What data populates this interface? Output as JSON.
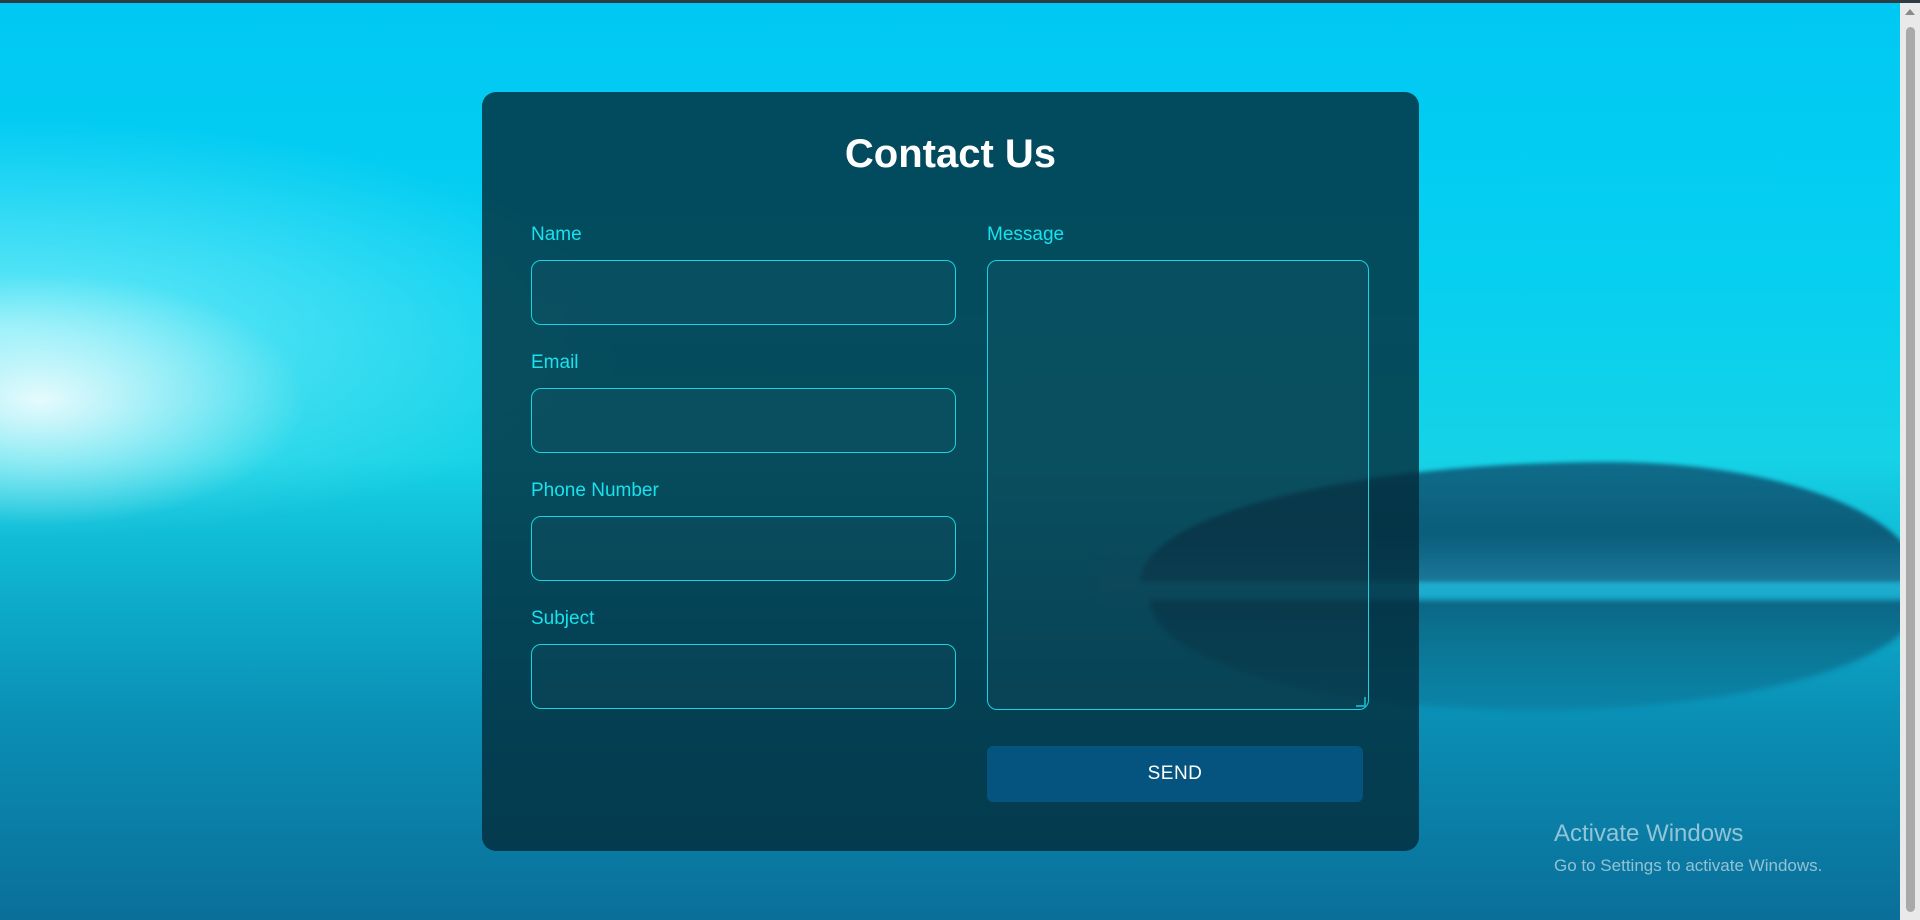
{
  "form": {
    "title": "Contact Us",
    "fields": {
      "name": {
        "label": "Name",
        "value": "",
        "placeholder": ""
      },
      "email": {
        "label": "Email",
        "value": "",
        "placeholder": ""
      },
      "phone": {
        "label": "Phone Number",
        "value": "",
        "placeholder": ""
      },
      "subject": {
        "label": "Subject",
        "value": "",
        "placeholder": ""
      },
      "message": {
        "label": "Message",
        "value": "",
        "placeholder": ""
      }
    },
    "send_label": "SEND"
  },
  "watermark": {
    "title": "Activate Windows",
    "subtitle": "Go to Settings to activate Windows."
  },
  "colors": {
    "accent": "#17e3ee",
    "card_background": "#022a3a",
    "button": "#04547f"
  }
}
